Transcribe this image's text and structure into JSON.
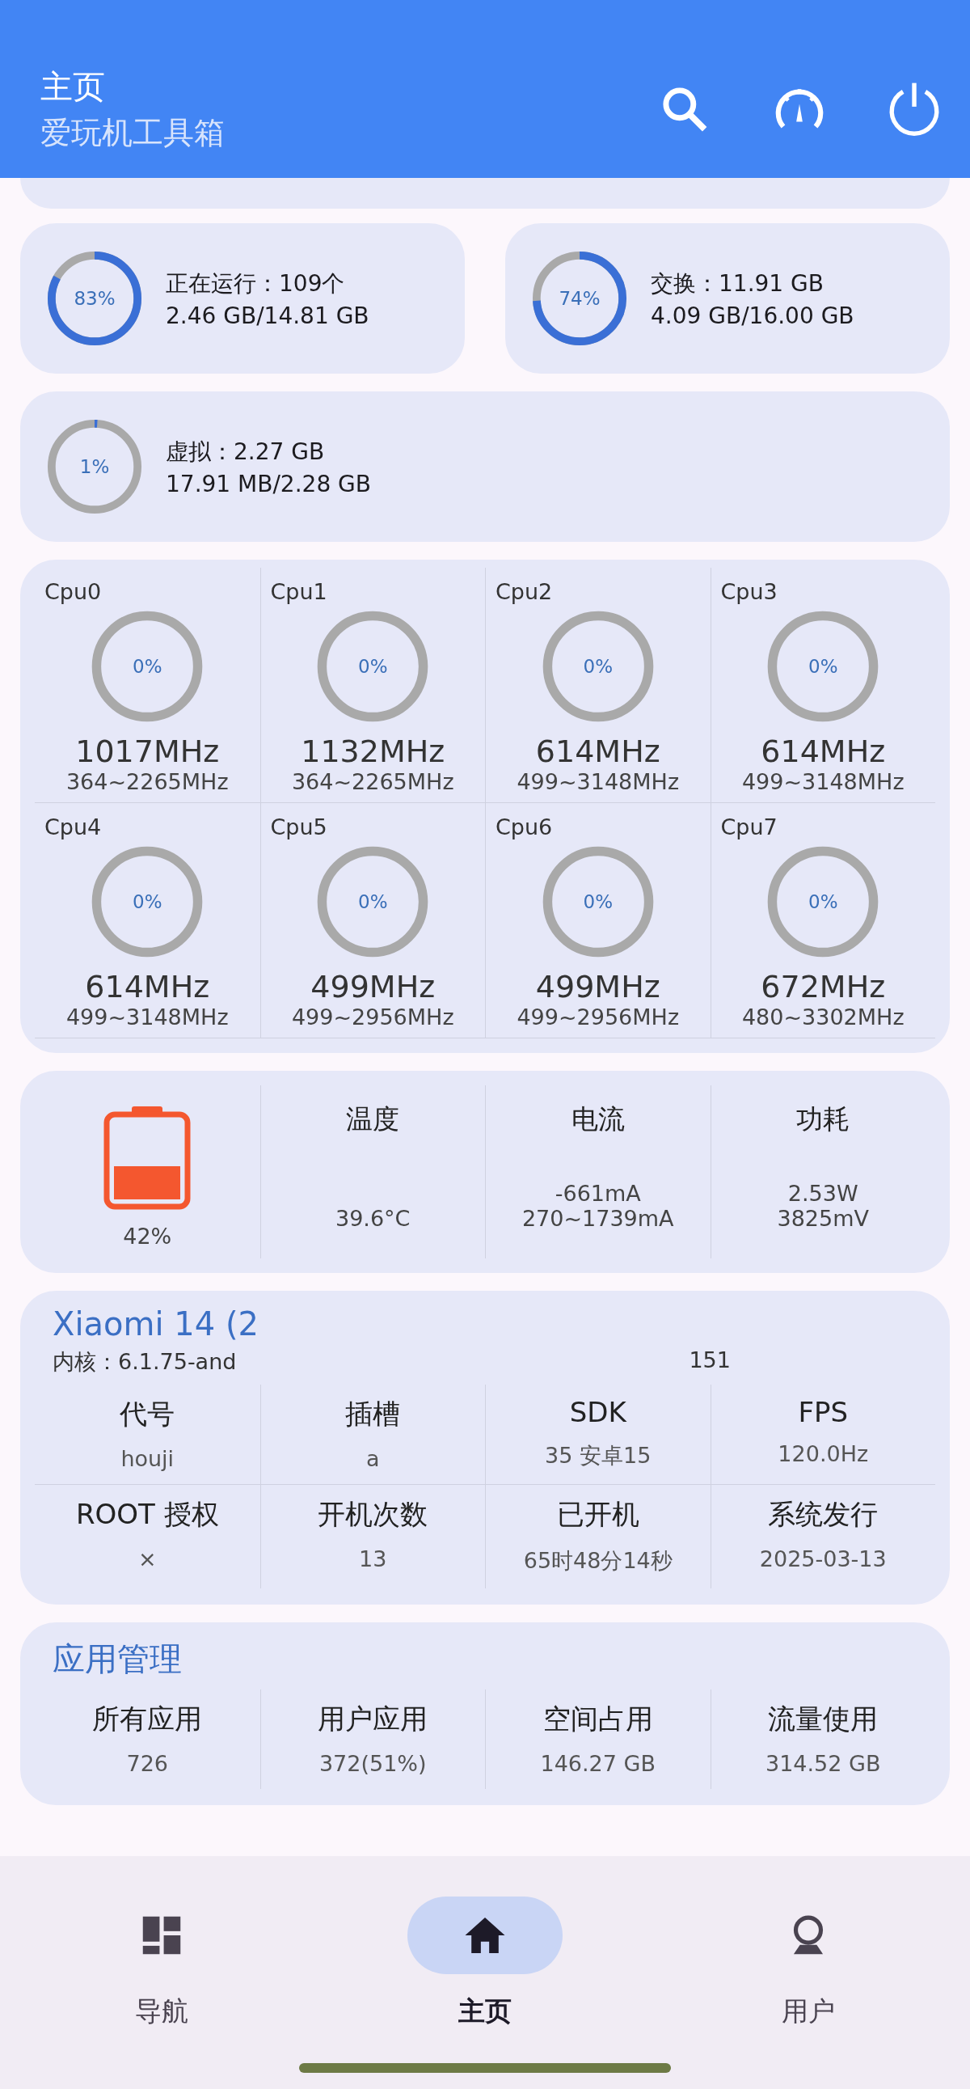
{
  "header": {
    "title": "主页",
    "subtitle": "爱玩机工具箱"
  },
  "memory": [
    {
      "label": "正在运行：109个",
      "detail": "2.46 GB/14.81 GB",
      "percent": "83%",
      "level": 0.83
    },
    {
      "label": "交换：11.91 GB",
      "detail": "4.09 GB/16.00 GB",
      "percent": "74%",
      "level": 0.74
    },
    {
      "label": "虚拟：2.27 GB",
      "detail": "17.91 MB/2.28 GB",
      "percent": "1%",
      "level": 0.01
    }
  ],
  "cpus": [
    {
      "name": "Cpu0",
      "percent": "0%",
      "level": 0,
      "freq": "1017MHz",
      "range": "364~2265MHz"
    },
    {
      "name": "Cpu1",
      "percent": "0%",
      "level": 0,
      "freq": "1132MHz",
      "range": "364~2265MHz"
    },
    {
      "name": "Cpu2",
      "percent": "0%",
      "level": 0,
      "freq": "614MHz",
      "range": "499~3148MHz"
    },
    {
      "name": "Cpu3",
      "percent": "0%",
      "level": 0,
      "freq": "614MHz",
      "range": "499~3148MHz"
    },
    {
      "name": "Cpu4",
      "percent": "0%",
      "level": 0,
      "freq": "614MHz",
      "range": "499~3148MHz"
    },
    {
      "name": "Cpu5",
      "percent": "0%",
      "level": 0,
      "freq": "499MHz",
      "range": "499~2956MHz"
    },
    {
      "name": "Cpu6",
      "percent": "0%",
      "level": 0,
      "freq": "499MHz",
      "range": "499~2956MHz"
    },
    {
      "name": "Cpu7",
      "percent": "0%",
      "level": 0,
      "freq": "672MHz",
      "range": "480~3302MHz"
    }
  ],
  "battery": {
    "percent": "42%",
    "stats": [
      {
        "label": "温度",
        "values": [
          "39.6°C"
        ]
      },
      {
        "label": "电流",
        "values": [
          "-661mA",
          "270~1739mA"
        ]
      },
      {
        "label": "功耗",
        "values": [
          "2.53W",
          "3825mV"
        ]
      }
    ]
  },
  "device": {
    "title": "Xiaomi 14 (2",
    "kernel": "内核：6.1.75-and",
    "kernel_tail": "151",
    "cells": [
      {
        "label": "代号",
        "value": "houji"
      },
      {
        "label": "插槽",
        "value": "a"
      },
      {
        "label": "SDK",
        "value": "35 安卓15"
      },
      {
        "label": "FPS",
        "value": "120.0Hz"
      },
      {
        "label": "ROOT 授权",
        "value": "×"
      },
      {
        "label": "开机次数",
        "value": "13"
      },
      {
        "label": "已开机",
        "value": "65时48分14秒"
      },
      {
        "label": "系统发行",
        "value": "2025-03-13"
      }
    ]
  },
  "apps": {
    "title": "应用管理",
    "cells": [
      {
        "label": "所有应用",
        "value": "726"
      },
      {
        "label": "用户应用",
        "value": "372(51%)"
      },
      {
        "label": "空间占用",
        "value": "146.27 GB"
      },
      {
        "label": "流量使用",
        "value": "314.52 GB"
      }
    ]
  },
  "nav": [
    {
      "label": "导航",
      "selected": false
    },
    {
      "label": "主页",
      "selected": true
    },
    {
      "label": "用户",
      "selected": false
    }
  ]
}
